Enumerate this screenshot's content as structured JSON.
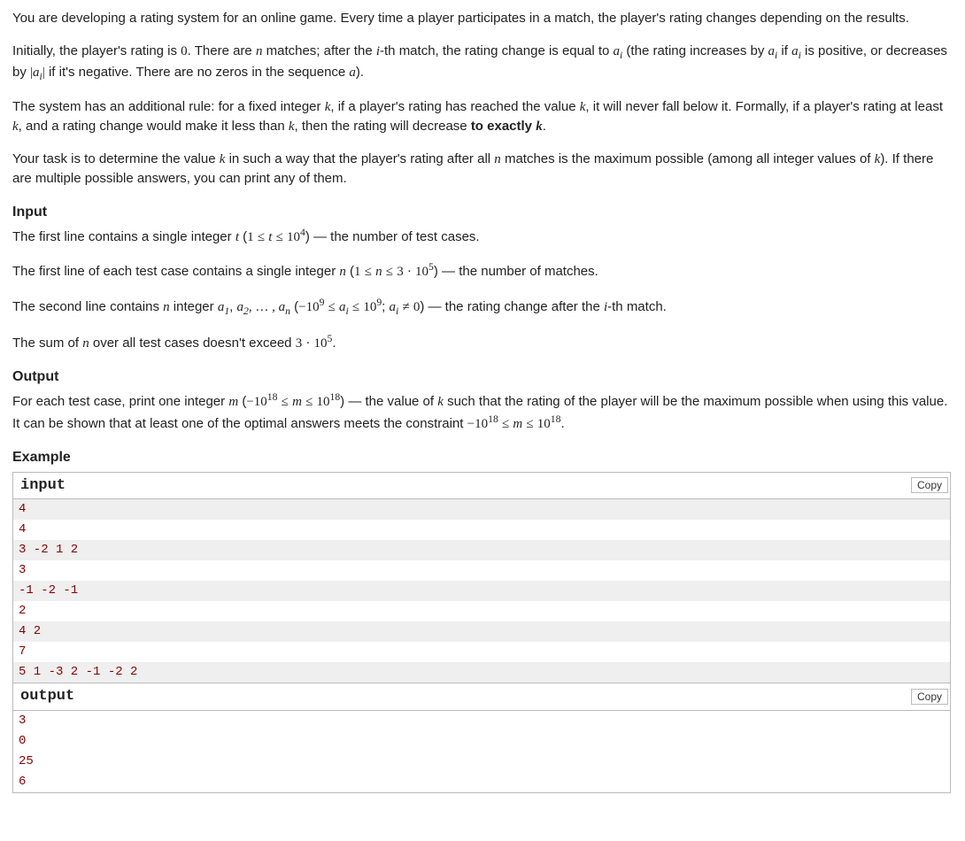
{
  "p1_a": "You are developing a rating system for an online game. Every time a player participates in a match, the player's rating changes depending on the results.",
  "p2_a": "Initially, the player's rating is ",
  "zero": "0",
  "p2_b": ". There are ",
  "n": "n",
  "p2_c": " matches; after the ",
  "i": "i",
  "p2_d": "-th match, the rating change is equal to ",
  "ai": "a",
  "ai_sub": "i",
  "p2_e": " (the rating increases by ",
  "p2_f": " if ",
  "p2_g": " is positive, or decreases by ",
  "abs_l": "|",
  "abs_r": "|",
  "p2_h": " if it's negative. There are no zeros in the sequence ",
  "a": "a",
  "p2_i": ").",
  "p3_a": "The system has an additional rule: for a fixed integer ",
  "k": "k",
  "p3_b": ", if a player's rating has reached the value ",
  "p3_c": ", it will never fall below it. Formally, if a player's rating at least ",
  "p3_d": ", and a rating change would make it less than ",
  "p3_e": ", then the rating will decrease ",
  "p3_f": "to exactly ",
  "p3_g": ".",
  "p4_a": "Your task is to determine the value ",
  "p4_b": " in such a way that the player's rating after all ",
  "p4_c": " matches is the maximum possible (among all integer values of ",
  "p4_d": "). If there are multiple possible answers, you can print any of them.",
  "input_h": "Input",
  "in1_a": "The first line contains a single integer ",
  "t": "t",
  "in1_b": " (",
  "le": "≤",
  "one": "1",
  "tmax": "10",
  "tmaxexp": "4",
  "in1_c": ") — the number of test cases.",
  "in2_a": "The first line of each test case contains a single integer ",
  "in2_b": " (",
  "three": "3",
  "dot": "·",
  "ten": "10",
  "five": "5",
  "in2_c": ") — the number of matches.",
  "in3_a": "The second line contains ",
  "in3_b": " integer ",
  "a1": "a",
  "a1s": "1",
  "comma": ", ",
  "a2": "a",
  "a2s": "2",
  "dots": ", … , ",
  "an": "a",
  "ans": "n",
  "in3_c": " (",
  "neg": "−",
  "nine": "9",
  "semi": "; ",
  "ne": "≠",
  "in3_d": ") — the rating change after the ",
  "in3_e": "-th match.",
  "in4_a": "The sum of ",
  "in4_b": " over all test cases doesn't exceed ",
  "in4_c": ".",
  "output_h": "Output",
  "out_a": "For each test case, print one integer ",
  "m": "m",
  "out_b": " (",
  "eighteen": "18",
  "out_c": ") — the value of ",
  "out_d": " such that the rating of the player will be the maximum possible when using this value. It can be shown that at least one of the optimal answers meets the constraint ",
  "out_e": ".",
  "example_h": "Example",
  "input_label": "input",
  "output_label": "output",
  "copy": "Copy",
  "input_lines": [
    "4",
    "4",
    "3 -2 1 2",
    "3",
    "-1 -2 -1",
    "2",
    "4 2",
    "7",
    "5 1 -3 2 -1 -2 2"
  ],
  "output_lines": [
    "3",
    "0",
    "25",
    "6"
  ]
}
